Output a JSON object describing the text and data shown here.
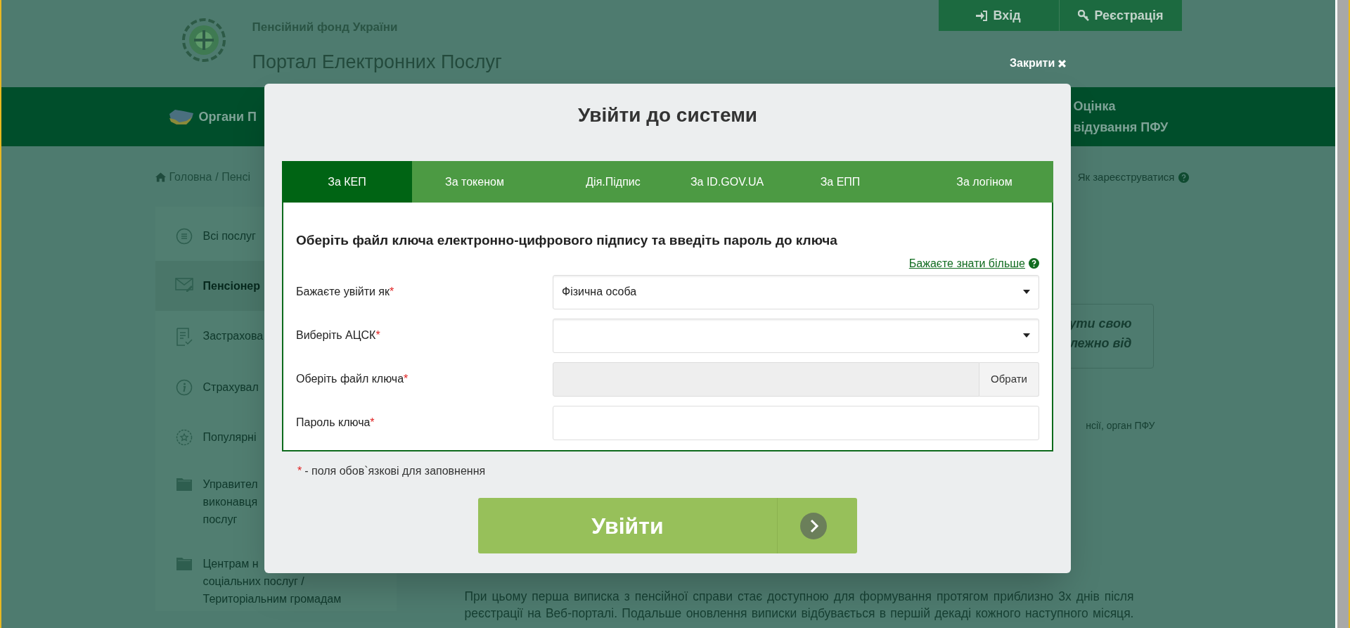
{
  "header": {
    "org": "Пенсійний фонд України",
    "portal": "Портал Електронних Послуг",
    "auth_buttons": [
      {
        "kind": "login",
        "label": "Вхід"
      },
      {
        "kind": "register",
        "label": "Реєстрація"
      }
    ],
    "close_label": "Закрити"
  },
  "nav": {
    "items": [
      {
        "lines": [
          "Органи П"
        ]
      },
      {
        "lines": [
          "Оцінка",
          "відування ПФУ"
        ]
      }
    ]
  },
  "breadcrumb": {
    "items": [
      "Головна",
      "Пенсі"
    ],
    "separator": "/",
    "help_link": "Як зареєструватися"
  },
  "sidebar": {
    "items": [
      {
        "lines": [
          "Всі послуг"
        ],
        "selected": false
      },
      {
        "lines": [
          "Пенсіонер"
        ],
        "selected": true
      },
      {
        "lines": [
          "Застрахова"
        ],
        "selected": false
      },
      {
        "lines": [
          "Страхувал"
        ],
        "selected": false
      },
      {
        "lines": [
          "Популярні"
        ],
        "selected": false
      },
      {
        "lines": [
          "Управител",
          "виконавця",
          "послуг"
        ],
        "selected": false
      },
      {
        "lines": [
          "Центрам н",
          "соціальних послуг /",
          "Територіальним громадам"
        ],
        "selected": false
      }
    ]
  },
  "content": {
    "notice_lines": [
      "ути свою",
      "лежно від"
    ],
    "text_fragment": "нсії, орган ПФУ",
    "paragraph": "При цьому перша виписка з пенсійної справи стає доступною для формування протягом приблизно 3х днів після реєстрації на Веб-порталі. Подальше оновлення виписки відбувається в першій декаді кожного наступного місяця."
  },
  "modal": {
    "title": "Увійти до системи",
    "tabs": [
      {
        "label": "За КЕП",
        "selected": true
      },
      {
        "label": "За токеном",
        "selected": false
      },
      {
        "label": "Дія.Підпис",
        "selected": false
      },
      {
        "label": "За ID.GOV.UA",
        "selected": false
      },
      {
        "label": "За ЕПП",
        "selected": false
      },
      {
        "label": "За логіном",
        "selected": false
      }
    ],
    "heading": "Оберіть файл ключа електронно-цифрового підпису та введіть пароль до ключа",
    "help_link": "Бажаєте знати більше",
    "fields": [
      {
        "kind": "select",
        "label": "Бажаєте увійти як",
        "required_mark": "*",
        "value": "Фізична особа"
      },
      {
        "kind": "select",
        "label": "Виберіть АЦСК",
        "required_mark": "*"
      },
      {
        "kind": "file",
        "label": "Оберіть файл ключа",
        "required_mark": "*",
        "button": "Обрати"
      },
      {
        "kind": "password",
        "label": "Пароль ключа",
        "required_mark": "*"
      }
    ],
    "required_note": {
      "mark": "*",
      "text": "- поля обов`язкові для заповнення"
    },
    "submit": "Увійти"
  }
}
